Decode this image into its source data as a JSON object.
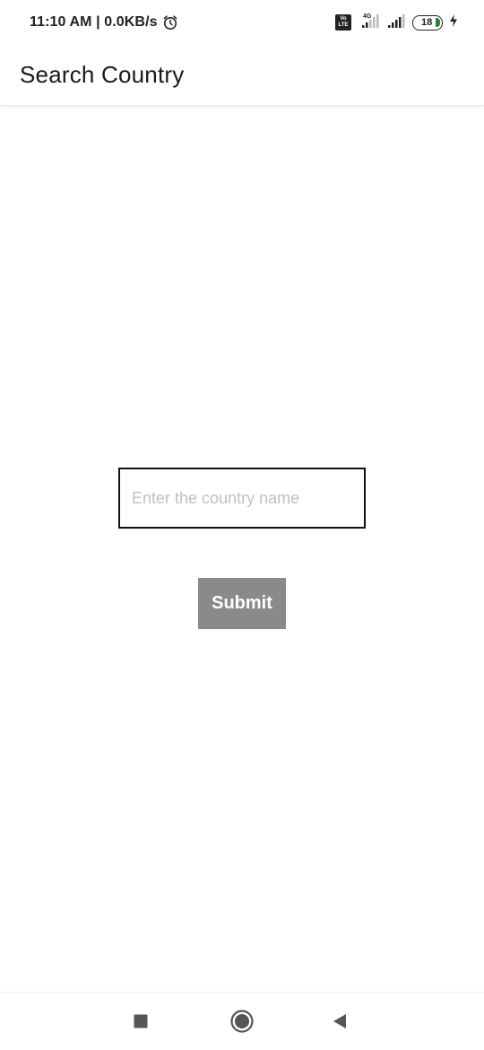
{
  "status_bar": {
    "time": "11:10 AM | 0.0KB/s",
    "alarm_icon": "alarm-icon",
    "volte_top": "Vo",
    "volte_bottom": "LTE",
    "network_type": "4G",
    "battery_level": "18",
    "charging_icon": "bolt-icon"
  },
  "app_bar": {
    "title": "Search Country"
  },
  "search": {
    "placeholder": "Enter the country name",
    "value": ""
  },
  "submit": {
    "label": "Submit",
    "color": "#8a8a8a"
  },
  "nav_bar": {
    "recent_icon": "square-recents-icon",
    "home_icon": "circle-home-icon",
    "back_icon": "triangle-back-icon"
  }
}
